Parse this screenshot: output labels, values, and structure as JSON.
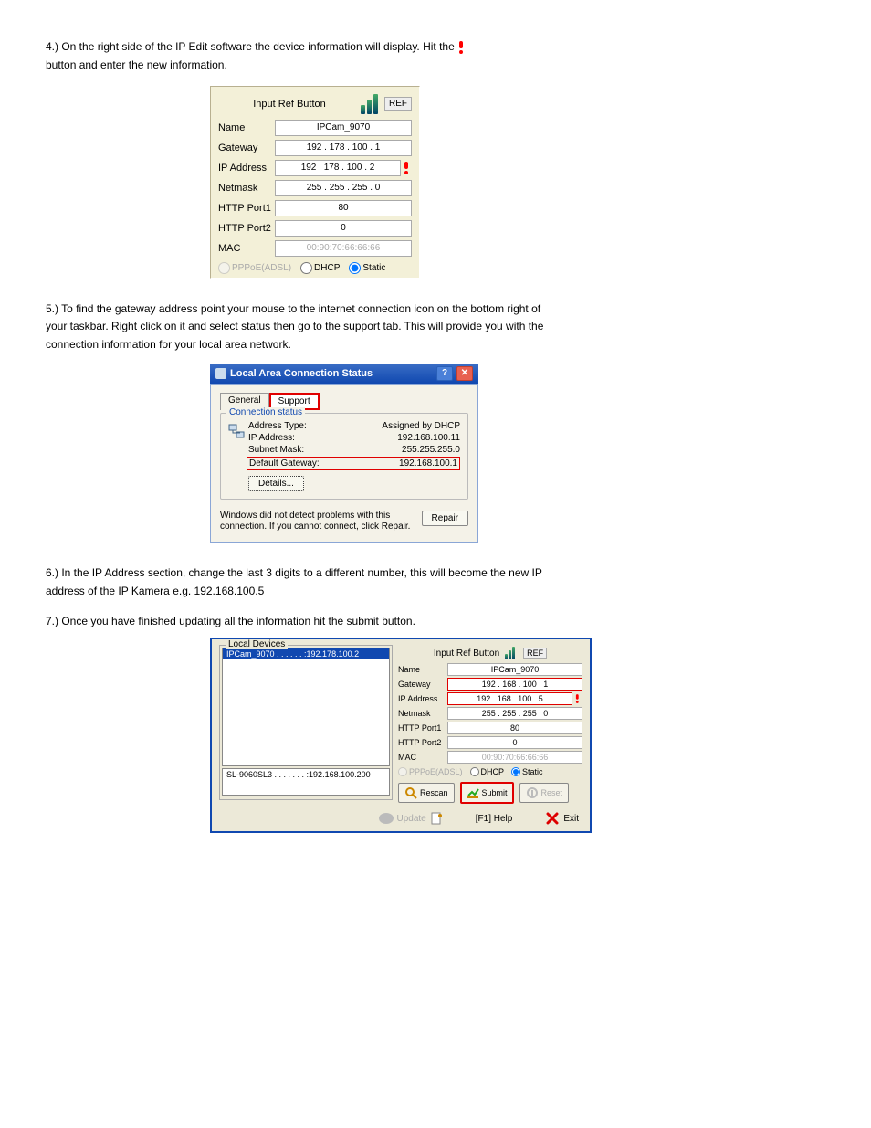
{
  "doc": {
    "line1": "4.) On the right side of the IP Edit software the device information will display. Hit the",
    "line2": "button and enter the new information.",
    "step5_a": "5.) To find the gateway address point your mouse to the internet connection icon on the bottom right of",
    "step5_b": "your taskbar. Right click on it and select status then go to the support tab. This will provide you with the",
    "step5_c": "connection information for your local area network.",
    "step6_a": "6.) In the IP Address section, change the last 3 digits to a different number, this will become the new IP",
    "step6_b": "address of the IP Kamera e.g. 192.168.100.5",
    "step7": "7.) Once you have finished updating all the information hit the submit button."
  },
  "panel1": {
    "title": "Input Ref Button",
    "ref": "REF",
    "labels": {
      "name": "Name",
      "gateway": "Gateway",
      "ip": "IP Address",
      "netmask": "Netmask",
      "port1": "HTTP Port1",
      "port2": "HTTP Port2",
      "mac": "MAC"
    },
    "values": {
      "name": "IPCam_9070",
      "gateway": "192 . 178 . 100 .   1",
      "ip": "192 . 178 . 100 .   2",
      "netmask": "255 . 255 . 255 .   0",
      "port1": "80",
      "port2": "0",
      "mac": "00:90:70:66:66:66"
    },
    "radios": {
      "pppoe": "PPPoE(ADSL)",
      "dhcp": "DHCP",
      "static": "Static"
    }
  },
  "panel2": {
    "title": "Local Area Connection Status",
    "tabs": {
      "general": "General",
      "support": "Support"
    },
    "group_legend": "Connection status",
    "rows": {
      "addr_type_k": "Address Type:",
      "addr_type_v": "Assigned by DHCP",
      "ip_k": "IP Address:",
      "ip_v": "192.168.100.11",
      "subnet_k": "Subnet Mask:",
      "subnet_v": "255.255.255.0",
      "gw_k": "Default Gateway:",
      "gw_v": "192.168.100.1"
    },
    "details": "Details...",
    "msg": "Windows did not detect problems with this connection. If you cannot connect, click Repair.",
    "repair": "Repair"
  },
  "panel3": {
    "local_legend": "Local Devices",
    "list_sel": "IPCam_9070 . . . . . . :192.178.100.2",
    "list2_row": "SL-9060SL3 . . . . . . . :192.168.100.200",
    "right": {
      "title": "Input Ref Button",
      "ref": "REF",
      "labels": {
        "name": "Name",
        "gateway": "Gateway",
        "ip": "IP Address",
        "netmask": "Netmask",
        "port1": "HTTP Port1",
        "port2": "HTTP Port2",
        "mac": "MAC"
      },
      "values": {
        "name": "IPCam_9070",
        "gateway": "192  .  168  .  100  .    1",
        "ip": "192  .  168  .  100  .    5",
        "netmask": "255  .  255  .  255  .    0",
        "port1": "80",
        "port2": "0",
        "mac": "00:90:70:66:66:66"
      },
      "radios": {
        "pppoe": "PPPoE(ADSL)",
        "dhcp": "DHCP",
        "static": "Static"
      },
      "buttons": {
        "rescan": "Rescan",
        "submit": "Submit",
        "reset": "Reset"
      }
    },
    "bottom": {
      "update": "Update",
      "help": "[F1] Help",
      "exit": "Exit"
    }
  }
}
